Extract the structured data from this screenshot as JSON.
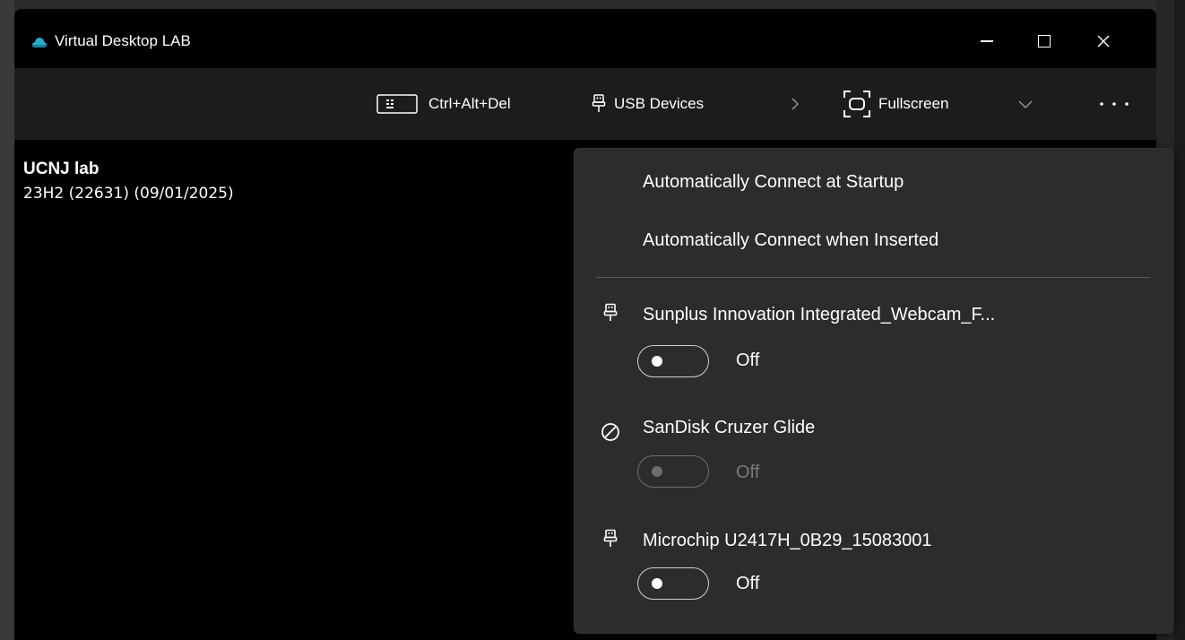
{
  "window": {
    "title": "Virtual Desktop LAB",
    "icon": "cloud-icon",
    "accent_color": "#2aa8c4"
  },
  "toolbar": {
    "ctrl_alt_del_label": "Ctrl+Alt+Del",
    "usb_devices_label": "USB Devices",
    "fullscreen_label": "Fullscreen"
  },
  "session": {
    "name": "UCNJ lab",
    "build": "23H2 (22631) (09/01/2025)"
  },
  "usb_menu": {
    "options": [
      "Automatically Connect at Startup",
      "Automatically Connect when Inserted"
    ],
    "devices": [
      {
        "name": "Sunplus Innovation Integrated_Webcam_F...",
        "state": "Off",
        "enabled": true,
        "icon": "usb-icon"
      },
      {
        "name": "SanDisk Cruzer Glide",
        "state": "Off",
        "enabled": false,
        "icon": "blocked-icon"
      },
      {
        "name": "Microchip U2417H_0B29_15083001",
        "state": "Off",
        "enabled": true,
        "icon": "usb-icon"
      }
    ]
  },
  "colors": {
    "window_bg": "#000000",
    "toolbar_bg": "#1c1c1c",
    "menu_bg": "#2c2c2c",
    "disabled_text": "#7a7a7a"
  }
}
